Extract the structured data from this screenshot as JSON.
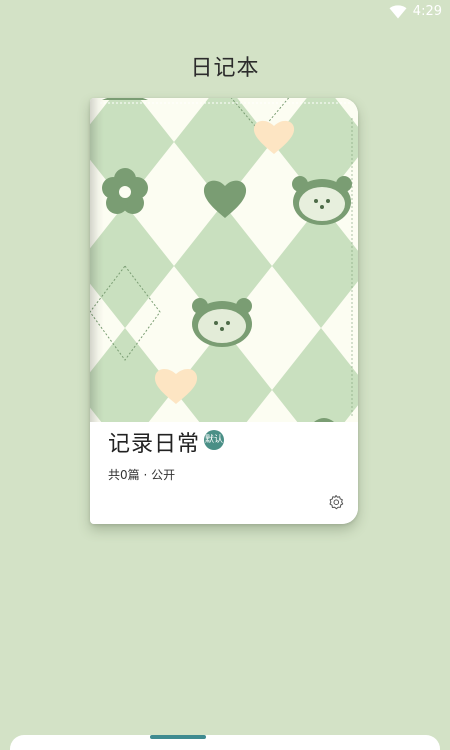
{
  "status_bar": {
    "time": "4:29",
    "icons": [
      "wifi-icon"
    ]
  },
  "header": {
    "title": "日记本"
  },
  "notebook": {
    "name": "记录日常",
    "badge": "默认",
    "meta": "共0篇 · 公开",
    "cover_icons": [
      "flower-icon",
      "heart-icon",
      "bear-face-icon"
    ],
    "colors": {
      "cover_green": "#c9e0bf",
      "cover_cream": "#fcfdf2",
      "motif_green": "#7a9d73",
      "heart_peach": "#fde5c3",
      "badge": "#4a8f86"
    }
  },
  "colors": {
    "background": "#d3e2c6",
    "bottom_handle": "#3f8b90"
  }
}
